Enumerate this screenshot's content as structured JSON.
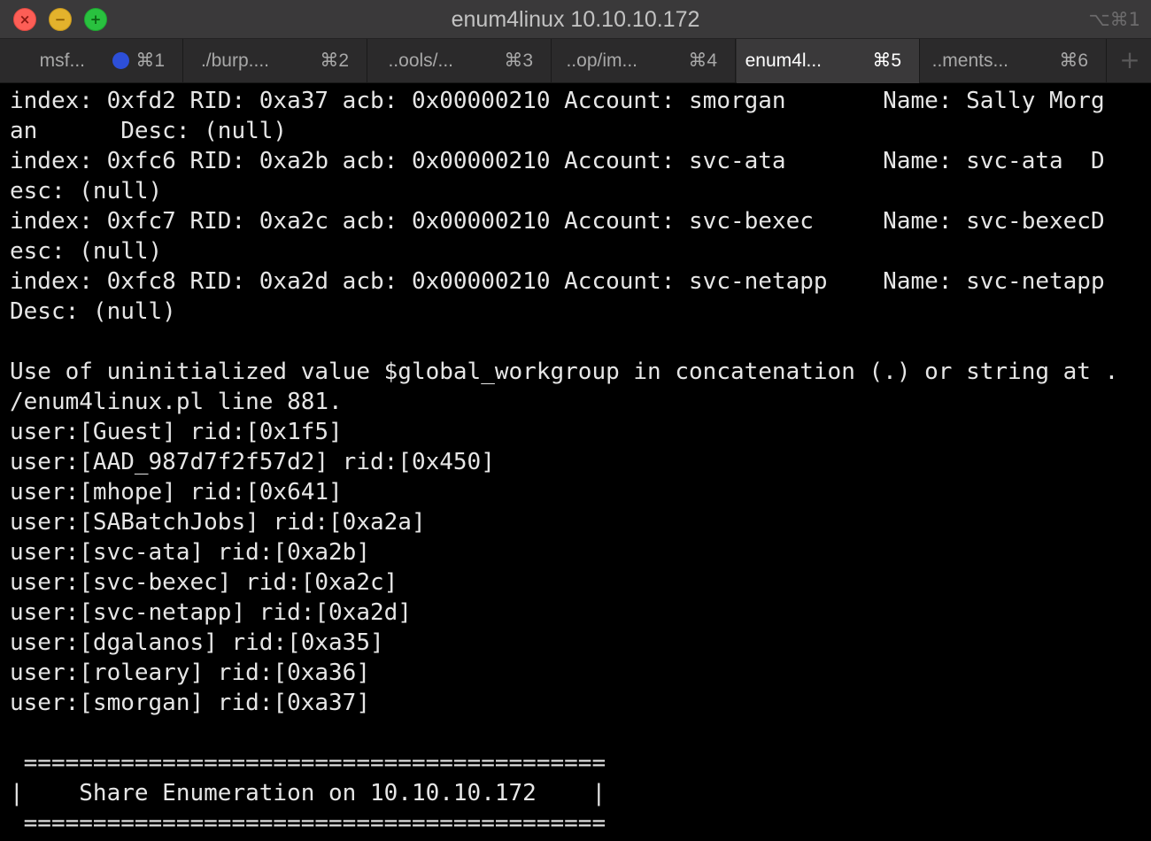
{
  "window": {
    "title": "enum4linux 10.10.10.172",
    "shortcut_hint": "⌥⌘1",
    "controls": {
      "close_glyph": "×",
      "minimize_glyph": "−",
      "zoom_glyph": "+"
    }
  },
  "tabs": [
    {
      "label": "msf...",
      "shortcut": "⌘1",
      "active": false,
      "activity_indicator": true
    },
    {
      "label": "./burp....",
      "shortcut": "⌘2",
      "active": false
    },
    {
      "label": "..ools/...",
      "shortcut": "⌘3",
      "active": false
    },
    {
      "label": "..op/im...",
      "shortcut": "⌘4",
      "active": false
    },
    {
      "label": "enum4l...",
      "shortcut": "⌘5",
      "active": true
    },
    {
      "label": "..ments...",
      "shortcut": "⌘6",
      "active": false
    }
  ],
  "new_tab_glyph": "+",
  "colors": {
    "terminal_background": "#000000",
    "terminal_text": "#e6e6e6",
    "close": "#fd5e56",
    "minimize": "#e3b22c",
    "zoom": "#29c13f",
    "activity_indicator": "#2d4fd8"
  },
  "terminal": {
    "lines": [
      "index: 0xfd2 RID: 0xa37 acb: 0x00000210 Account: smorgan       Name: Sally Morg",
      "an      Desc: (null)",
      "index: 0xfc6 RID: 0xa2b acb: 0x00000210 Account: svc-ata       Name: svc-ata  D",
      "esc: (null)",
      "index: 0xfc7 RID: 0xa2c acb: 0x00000210 Account: svc-bexec     Name: svc-bexecD",
      "esc: (null)",
      "index: 0xfc8 RID: 0xa2d acb: 0x00000210 Account: svc-netapp    Name: svc-netapp",
      "Desc: (null)",
      "",
      "Use of uninitialized value $global_workgroup in concatenation (.) or string at .",
      "/enum4linux.pl line 881.",
      "user:[Guest] rid:[0x1f5]",
      "user:[AAD_987d7f2f57d2] rid:[0x450]",
      "user:[mhope] rid:[0x641]",
      "user:[SABatchJobs] rid:[0xa2a]",
      "user:[svc-ata] rid:[0xa2b]",
      "user:[svc-bexec] rid:[0xa2c]",
      "user:[svc-netapp] rid:[0xa2d]",
      "user:[dgalanos] rid:[0xa35]",
      "user:[roleary] rid:[0xa36]",
      "user:[smorgan] rid:[0xa37]",
      "",
      " ==========================================",
      "|    Share Enumeration on 10.10.10.172    |",
      " =========================================="
    ]
  }
}
